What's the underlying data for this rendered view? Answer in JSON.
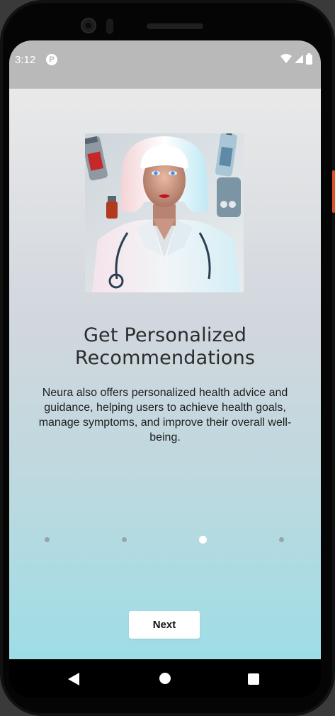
{
  "status_bar": {
    "time": "3:12",
    "app_icon": "app-notification-icon",
    "icons": [
      "wifi-icon",
      "cell-signal-icon",
      "battery-icon"
    ]
  },
  "onboarding": {
    "hero_image": "nurse-illustration",
    "title": "Get Personalized Recommendations",
    "description": "Neura also offers personalized health advice and guidance, helping users to achieve health goals, manage symptoms, and improve their overall well-being.",
    "pagination": {
      "total": 4,
      "current": 3
    },
    "next_label": "Next"
  },
  "navigation_bar": {
    "icons": [
      "back-icon",
      "home-icon",
      "recents-icon"
    ]
  },
  "colors": {
    "status_bar_bg": "#b9b9b9",
    "gradient_top": "#e9e9e9",
    "gradient_bottom": "#9edde6",
    "button_bg": "#ffffff",
    "dot_inactive": "#9aa3a6",
    "dot_active": "#ffffff"
  }
}
